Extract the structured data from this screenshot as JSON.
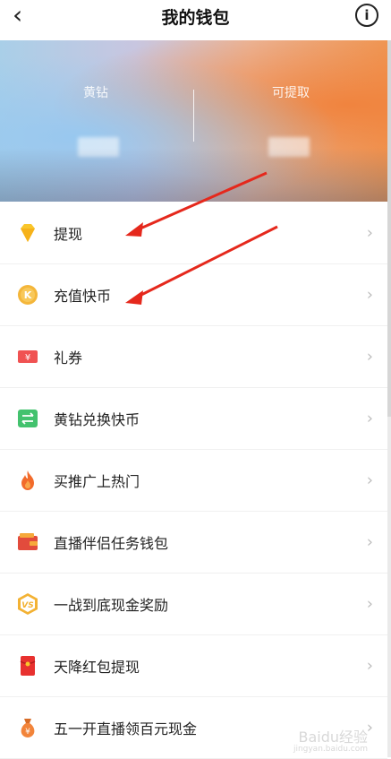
{
  "header": {
    "title": "我的钱包",
    "back_icon": "chevron-left-icon",
    "info_icon": "info-icon"
  },
  "banner": {
    "left_label": "黄钻",
    "right_label": "可提取"
  },
  "menu": [
    {
      "label": "提现",
      "icon": "diamond-icon",
      "color": "#F9C62B"
    },
    {
      "label": "充值快币",
      "icon": "coin-icon",
      "color": "#F4B63A"
    },
    {
      "label": "礼券",
      "icon": "coupon-icon",
      "color": "#F05252"
    },
    {
      "label": "黄钻兑换快币",
      "icon": "exchange-icon",
      "color": "#43C26E"
    },
    {
      "label": "买推广上热门",
      "icon": "flame-icon",
      "color": "#F26B2B"
    },
    {
      "label": "直播伴侣任务钱包",
      "icon": "wallet-icon",
      "color": "#E24B3C"
    },
    {
      "label": "一战到底现金奖励",
      "icon": "vs-badge-icon",
      "color": "#F3B234"
    },
    {
      "label": "天降红包提现",
      "icon": "red-envelope-icon",
      "color": "#E8312F"
    },
    {
      "label": "五一开直播领百元现金",
      "icon": "money-bag-icon",
      "color": "#F2843A"
    }
  ],
  "watermark": {
    "text": "Baidu经验",
    "sub": "jingyan.baidu.com"
  }
}
